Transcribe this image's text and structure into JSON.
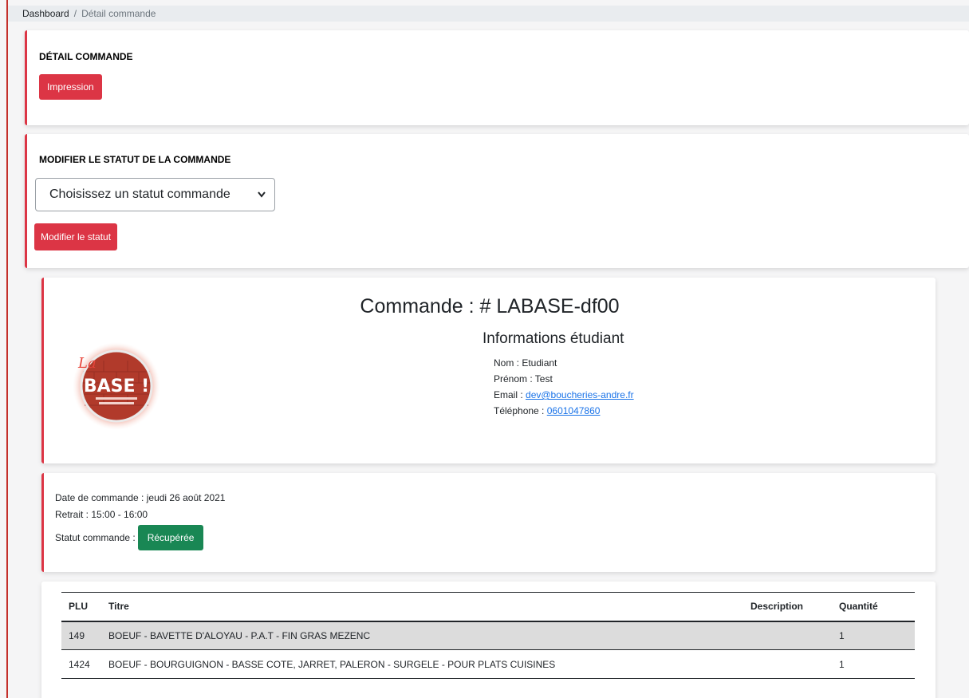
{
  "breadcrumb": {
    "home": "Dashboard",
    "separator": "/",
    "current": "Détail commande"
  },
  "detail_card": {
    "title": "DÉTAIL COMMANDE",
    "print_button": "Impression"
  },
  "status_card": {
    "title": "MODIFIER LE STATUT DE LA COMMANDE",
    "select_value": "Choisissez un statut commande",
    "submit_button": "Modifier le statut"
  },
  "order": {
    "title": "Commande : # LABASE-df00",
    "logo_text": "BASE !",
    "logo_script": "La",
    "student_section_title": "Informations étudiant",
    "nom_label": "Nom : Etudiant",
    "prenom_label": "Prénom : Test",
    "email_label": "Email : ",
    "email_value": "dev@boucheries-andre.fr",
    "phone_label": "Téléphone : ",
    "phone_value": "0601047860"
  },
  "order_details": {
    "date": "Date de commande : jeudi 26 août 2021",
    "retrait": "Retrait : 15:00 - 16:00",
    "statut_label": "Statut commande :",
    "statut_value": "Récupérée"
  },
  "products": {
    "headers": {
      "plu": "PLU",
      "titre": "Titre",
      "description": "Description",
      "quantite": "Quantité"
    },
    "rows": [
      {
        "plu": "149",
        "titre": "BOEUF - BAVETTE D'ALOYAU - P.A.T - FIN GRAS MEZENC",
        "description": "",
        "quantite": "1"
      },
      {
        "plu": "1424",
        "titre": "BOEUF - BOURGUIGNON - BASSE COTE, JARRET, PALERON - SURGELE - POUR PLATS CUISINES",
        "description": "",
        "quantite": "1"
      }
    ]
  },
  "colors": {
    "accent": "#dc3545",
    "success": "#198754",
    "link": "#1a73e8"
  }
}
